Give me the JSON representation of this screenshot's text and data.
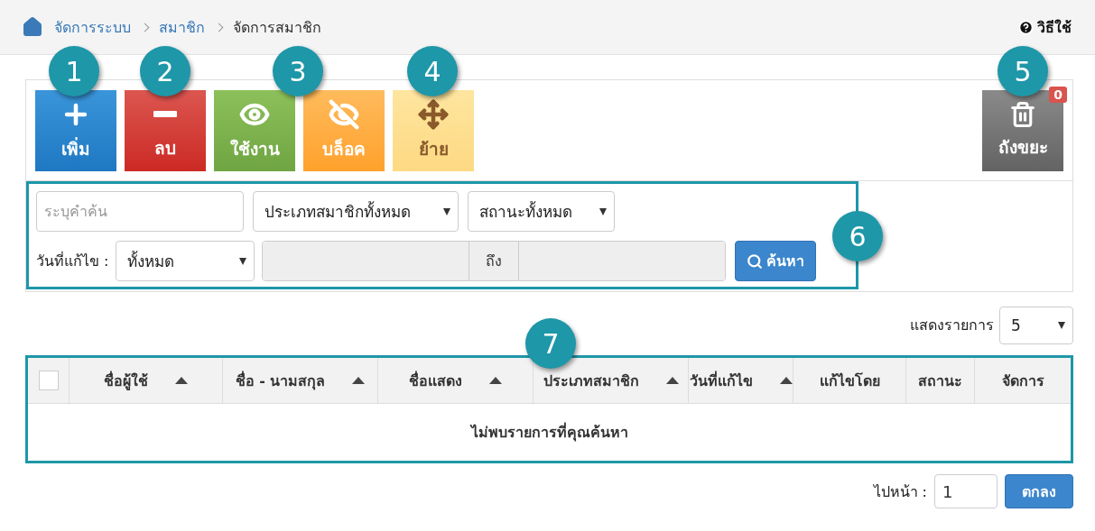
{
  "breadcrumb": [
    {
      "label": "จัดการระบบ",
      "kind": "home"
    },
    {
      "label": "สมาชิก",
      "kind": "link"
    },
    {
      "label": "จัดการสมาชิก",
      "kind": "current"
    }
  ],
  "help": {
    "label": "วิธีใช้"
  },
  "toolbar": {
    "buttons": [
      {
        "label": "เพิ่ม",
        "kind": "add"
      },
      {
        "label": "ลบ",
        "kind": "delete"
      },
      {
        "label": "ใช้งาน",
        "kind": "enable"
      },
      {
        "label": "บล็อค",
        "kind": "block"
      },
      {
        "label": "ย้าย",
        "kind": "move"
      }
    ],
    "callouts": [
      "1",
      "2",
      "3",
      "4"
    ]
  },
  "trash": {
    "label": "ถังขยะ",
    "badge": "0",
    "callout": "5"
  },
  "filters": {
    "callout": "6",
    "search": {
      "placeholder": "ระบุคำค้น"
    },
    "member_type": "ประเภทสมาชิกทั้งหมด",
    "status": "สถานะทั้งหมด",
    "date_label": "วันที่แก้ไข :",
    "date_option": "ทั้งหมด",
    "range_separator": "ถึง",
    "search_button": "ค้นหา"
  },
  "page_size": {
    "label": "แสดงรายการ",
    "value": "5"
  },
  "table": {
    "callout": "7",
    "select_all": {
      "checked": false
    },
    "columns": [
      {
        "label": "ชื่อผู้ใช้",
        "sortable": true
      },
      {
        "label": "ชื่อ - นามสกุล",
        "sortable": true
      },
      {
        "label": "ชื่อแสดง",
        "sortable": true
      },
      {
        "label": "ประเภทสมาชิก",
        "sortable": true
      },
      {
        "label": "วันที่แก้ไข",
        "sortable": true
      },
      {
        "label": "แก้ไขโดย",
        "sortable": false
      },
      {
        "label": "สถานะ",
        "sortable": false
      },
      {
        "label": "จัดการ",
        "sortable": false
      }
    ],
    "empty_message": "ไม่พบรายการที่คุณค้นหา"
  },
  "pagination": {
    "label": "ไปหน้า :",
    "page": "1",
    "button": "ตกลง"
  }
}
